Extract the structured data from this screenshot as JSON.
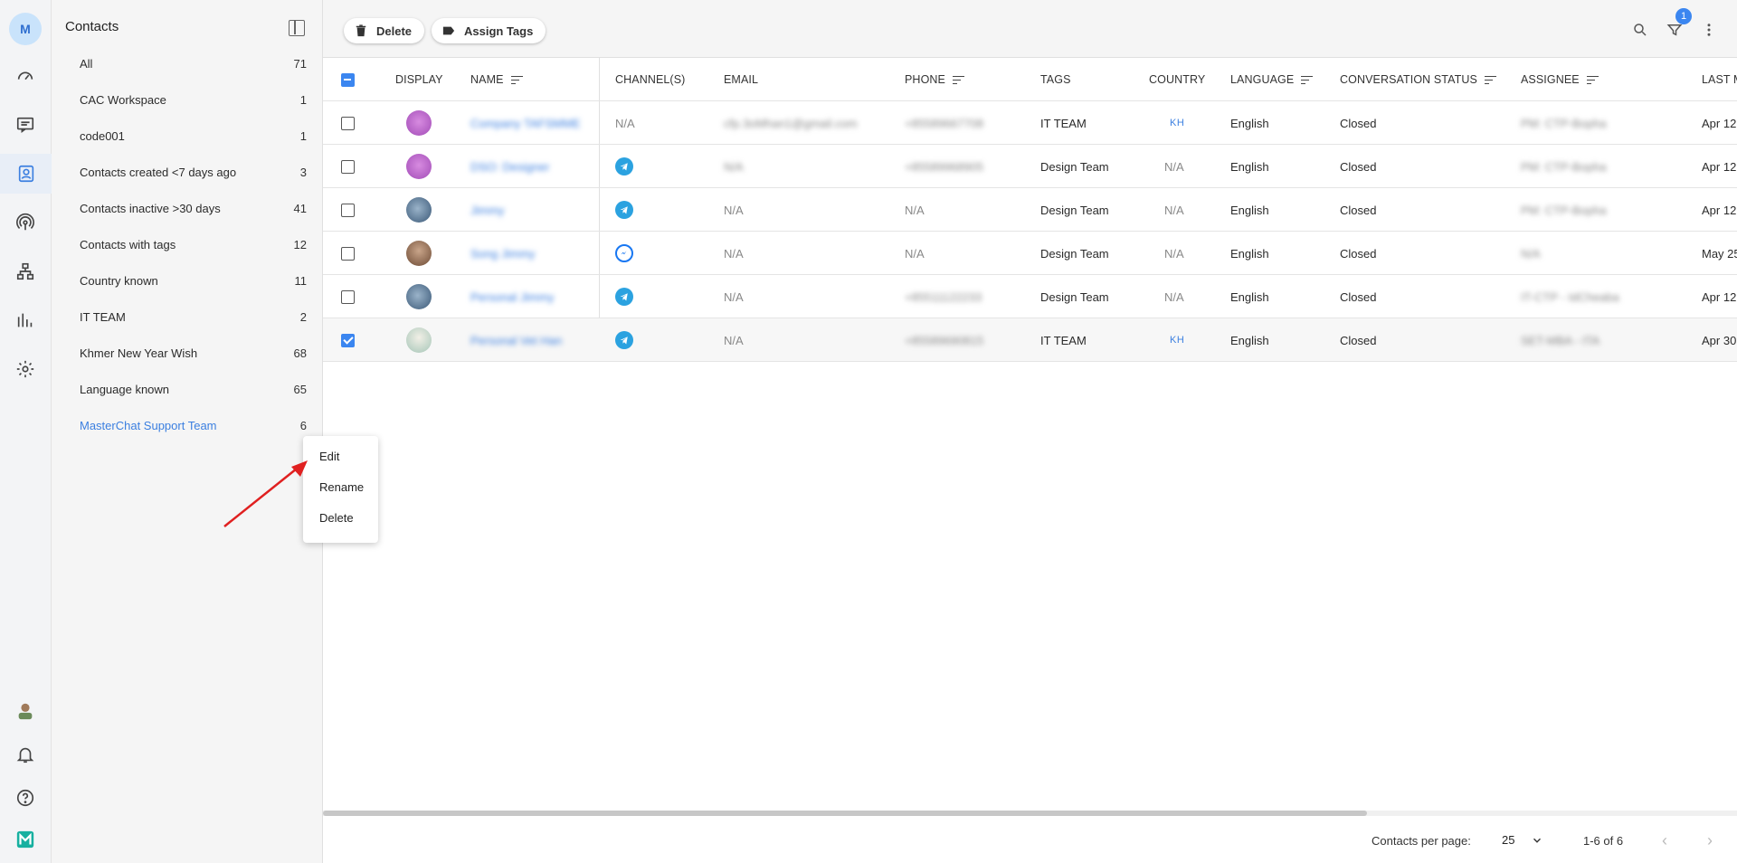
{
  "rail": {
    "avatar_letter": "M"
  },
  "sidebar": {
    "title": "Contacts",
    "items": [
      {
        "label": "All",
        "count": "71"
      },
      {
        "label": "CAC Workspace",
        "count": "1"
      },
      {
        "label": "code001",
        "count": "1"
      },
      {
        "label": "Contacts created <7 days ago",
        "count": "3"
      },
      {
        "label": "Contacts inactive >30 days",
        "count": "41"
      },
      {
        "label": "Contacts with tags",
        "count": "12"
      },
      {
        "label": "Country known",
        "count": "11"
      },
      {
        "label": "IT TEAM",
        "count": "2"
      },
      {
        "label": "Khmer New Year Wish",
        "count": "68"
      },
      {
        "label": "Language known",
        "count": "65"
      },
      {
        "label": "MasterChat Support Team",
        "count": "6"
      }
    ]
  },
  "context_menu": {
    "items": [
      "Edit",
      "Rename",
      "Delete"
    ]
  },
  "toolbar": {
    "delete_label": "Delete",
    "assign_tags_label": "Assign Tags",
    "filter_badge": "1"
  },
  "table": {
    "headers": {
      "display": "DISPLAY",
      "name": "NAME",
      "channels": "CHANNEL(S)",
      "email": "EMAIL",
      "phone": "PHONE",
      "tags": "TAGS",
      "country": "COUNTRY",
      "language": "LANGUAGE",
      "status": "CONVERSATION STATUS",
      "assignee": "ASSIGNEE",
      "last": "LAST M"
    },
    "rows": [
      {
        "name": "Company TAFSMME",
        "channel": "N/A",
        "email": "cfp.3oMhan1@gmail.com",
        "phone": "+85589667708",
        "tags": "IT TEAM",
        "country": "KH",
        "language": "English",
        "status": "Closed",
        "assignee": "PM: CTP-Bopha",
        "last": "Apr 12"
      },
      {
        "name": "DSO: Designer",
        "channel": "",
        "email": "N/A",
        "phone": "+85589968905",
        "tags": "Design Team",
        "country": "N/A",
        "language": "English",
        "status": "Closed",
        "assignee": "PM: CTP-Bopha",
        "last": "Apr 12"
      },
      {
        "name": "Jimmy",
        "channel": "",
        "email": "N/A",
        "phone": "N/A",
        "tags": "Design Team",
        "country": "N/A",
        "language": "English",
        "status": "Closed",
        "assignee": "PM: CTP-Bopha",
        "last": "Apr 12"
      },
      {
        "name": "Song Jimmy",
        "channel": "",
        "email": "N/A",
        "phone": "N/A",
        "tags": "Design Team",
        "country": "N/A",
        "language": "English",
        "status": "Closed",
        "assignee": "N/A",
        "last": "May 25"
      },
      {
        "name": "Personal Jimmy",
        "channel": "",
        "email": "N/A",
        "phone": "+85511122233",
        "tags": "Design Team",
        "country": "N/A",
        "language": "English",
        "status": "Closed",
        "assignee": "IT-CTP - IdCheaba",
        "last": "Apr 12"
      },
      {
        "name": "Personal Vet Han",
        "channel": "",
        "email": "N/A",
        "phone": "+85589690815",
        "tags": "IT TEAM",
        "country": "KH",
        "language": "English",
        "status": "Closed",
        "assignee": "SET-MBA - ITA",
        "last": "Apr 30"
      }
    ]
  },
  "footer": {
    "rpp_label": "Contacts per page:",
    "rpp_value": "25",
    "range": "1-6 of 6"
  }
}
